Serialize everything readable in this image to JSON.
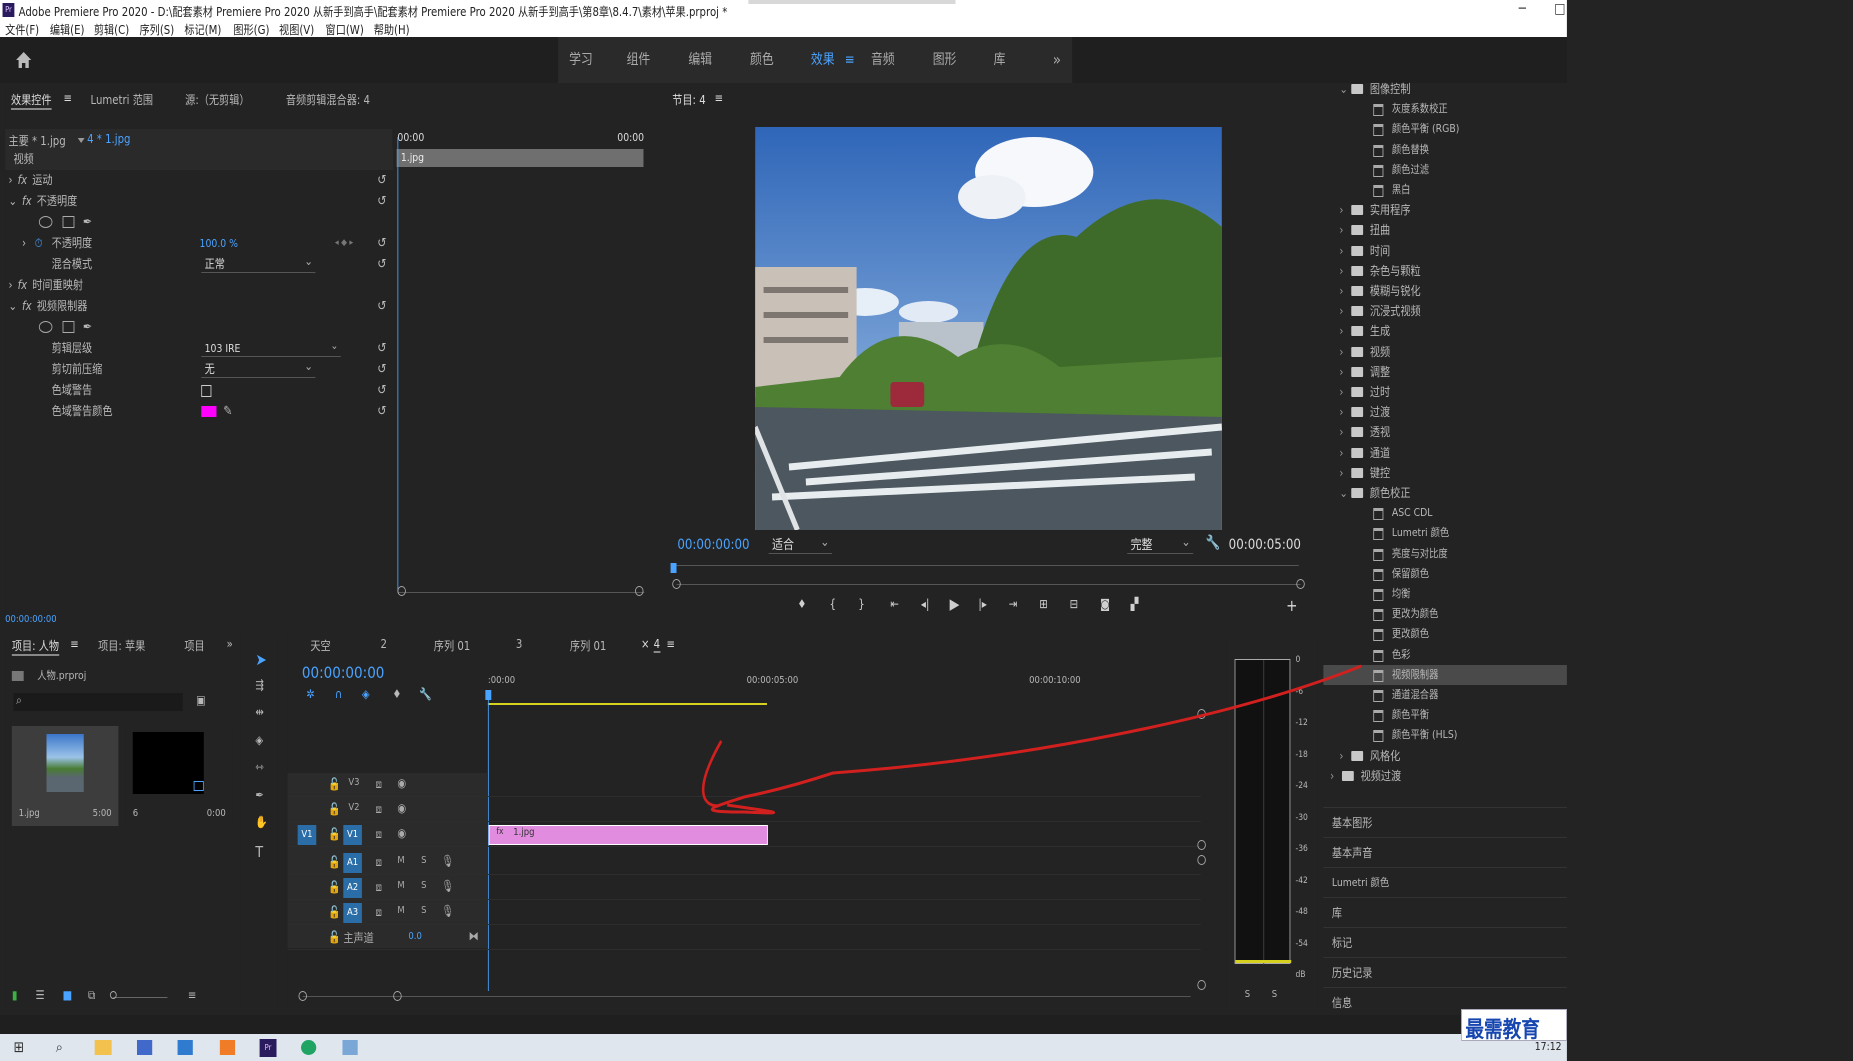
{
  "window": {
    "title": "Adobe Premiere Pro 2020 - D:\\配套素材 Premiere Pro 2020 从新手到高手\\配套素材 Premiere Pro 2020 从新手到高手\\第8章\\8.4.7\\素材\\苹果.prproj *",
    "minimize": "─",
    "maximize": "□",
    "app_icon": "Pr"
  },
  "menu": [
    "文件(F)",
    "编辑(E)",
    "剪辑(C)",
    "序列(S)",
    "标记(M)",
    "图形(G)",
    "视图(V)",
    "窗口(W)",
    "帮助(H)"
  ],
  "workspaces": {
    "items": [
      "学习",
      "组件",
      "编辑",
      "颜色",
      "效果",
      "音频",
      "图形",
      "库"
    ],
    "active": "效果",
    "more": "»",
    "menu": "≡"
  },
  "effect_controls": {
    "tabs": [
      "效果控件",
      "Lumetri 范围",
      "源:（无剪辑）",
      "音频剪辑混合器: 4"
    ],
    "tab_menu": "≡",
    "master": "主要 * 1.jpg",
    "clip": "4 * 1.jpg",
    "time_start": "00:00",
    "time_end": "00:00",
    "clip_bar": "1.jpg",
    "section": "视频",
    "rows": {
      "motion": "运动",
      "opacity": "不透明度",
      "opacity_prop": "不透明度",
      "opacity_val": "100.0 %",
      "blend": "混合模式",
      "blend_val": "正常",
      "remap": "时间重映射",
      "limiter": "视频限制器",
      "clip_level": "剪辑层级",
      "clip_level_val": "103 IRE",
      "compress": "剪切前压缩",
      "compress_val": "无",
      "gamut": "色域警告",
      "gamut_color": "色域警告颜色"
    },
    "fx": "fx",
    "timecode": "00:00:00:00"
  },
  "program": {
    "title": "节目: 4",
    "menu": "≡",
    "timecode": "00:00:00:00",
    "fit": "适合",
    "quality": "完整",
    "duration": "00:00:05:00",
    "add": "+"
  },
  "effects": {
    "items": [
      {
        "label": "图像控制",
        "kind": "folder",
        "open": true
      },
      {
        "label": "灰度系数校正",
        "kind": "fx"
      },
      {
        "label": "颜色平衡 (RGB)",
        "kind": "fx"
      },
      {
        "label": "颜色替换",
        "kind": "fx"
      },
      {
        "label": "颜色过滤",
        "kind": "fx"
      },
      {
        "label": "黑白",
        "kind": "fx"
      },
      {
        "label": "实用程序",
        "kind": "folder"
      },
      {
        "label": "扭曲",
        "kind": "folder"
      },
      {
        "label": "时间",
        "kind": "folder"
      },
      {
        "label": "杂色与颗粒",
        "kind": "folder"
      },
      {
        "label": "模糊与锐化",
        "kind": "folder"
      },
      {
        "label": "沉浸式视频",
        "kind": "folder"
      },
      {
        "label": "生成",
        "kind": "folder"
      },
      {
        "label": "视频",
        "kind": "folder"
      },
      {
        "label": "调整",
        "kind": "folder"
      },
      {
        "label": "过时",
        "kind": "folder"
      },
      {
        "label": "过渡",
        "kind": "folder"
      },
      {
        "label": "透视",
        "kind": "folder"
      },
      {
        "label": "通道",
        "kind": "folder"
      },
      {
        "label": "键控",
        "kind": "folder"
      },
      {
        "label": "颜色校正",
        "kind": "folder",
        "open": true
      },
      {
        "label": "ASC CDL",
        "kind": "fx"
      },
      {
        "label": "Lumetri 颜色",
        "kind": "fx"
      },
      {
        "label": "亮度与对比度",
        "kind": "fx"
      },
      {
        "label": "保留颜色",
        "kind": "fx"
      },
      {
        "label": "均衡",
        "kind": "fx"
      },
      {
        "label": "更改为颜色",
        "kind": "fx"
      },
      {
        "label": "更改颜色",
        "kind": "fx"
      },
      {
        "label": "色彩",
        "kind": "fx"
      },
      {
        "label": "视频限制器",
        "kind": "fx",
        "selected": true
      },
      {
        "label": "通道混合器",
        "kind": "fx"
      },
      {
        "label": "颜色平衡",
        "kind": "fx"
      },
      {
        "label": "颜色平衡 (HLS)",
        "kind": "fx"
      },
      {
        "label": "风格化",
        "kind": "folder"
      },
      {
        "label": "视频过渡",
        "kind": "folder",
        "top": true
      }
    ],
    "panels": [
      "基本图形",
      "基本声音",
      "Lumetri 颜色",
      "库",
      "标记",
      "历史记录",
      "信息"
    ]
  },
  "project": {
    "tabs": [
      "项目: 人物",
      "项目: 苹果",
      "项目"
    ],
    "menu": "≡",
    "more": "»",
    "file": "人物.prproj",
    "search_placeholder": "",
    "items": [
      {
        "name": "1.jpg",
        "dur": "5:00"
      },
      {
        "name": "6",
        "dur": "0:00"
      }
    ]
  },
  "timeline": {
    "tabs": [
      "天空",
      "2",
      "序列 01",
      "3",
      "序列 01",
      "4"
    ],
    "close": "×",
    "menu": "≡",
    "timecode": "00:00:00:00",
    "ruler": [
      ":00:00",
      "00:00:05:00",
      "00:00:10:00"
    ],
    "tracks_v": [
      "V3",
      "V2",
      "V1"
    ],
    "tracks_a": [
      "A1",
      "A2",
      "A3"
    ],
    "master": "主声道",
    "master_val": "0.0",
    "src_v1": "V1",
    "clip": "1.jpg",
    "m": "M",
    "s": "S"
  },
  "meter": {
    "ticks": [
      "0",
      "-6",
      "-12",
      "-18",
      "-24",
      "-30",
      "-36",
      "-42",
      "-48",
      "-54",
      "dB"
    ],
    "solo": [
      "S",
      "S"
    ]
  },
  "taskbar": {
    "time": "17:12",
    "watermark": "最需教育"
  },
  "colors": {
    "accent": "#2d8ceb",
    "clip": "#e28ce0",
    "gamut_swatch": "#ff00ff",
    "annot": "#d2201f"
  }
}
